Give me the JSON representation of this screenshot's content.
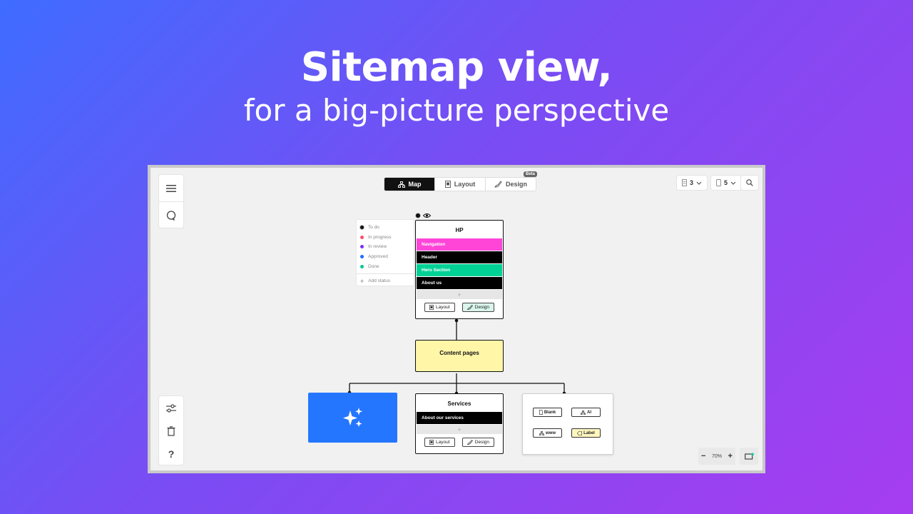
{
  "hero": {
    "title": "Sitemap view,",
    "subtitle": "for a big-picture perspective"
  },
  "toolbar": {
    "tabs": [
      {
        "label": "Map",
        "icon": "sitemap-icon",
        "active": true
      },
      {
        "label": "Layout",
        "icon": "layout-icon",
        "active": false
      },
      {
        "label": "Design",
        "icon": "design-icon",
        "active": false,
        "badge": "Beta"
      }
    ],
    "page_count": "3",
    "device_count": "5"
  },
  "sidebar": {
    "top": [
      "menu-icon",
      "comment-icon"
    ],
    "bottom": [
      "settings-sliders-icon",
      "trash-icon",
      "help-icon"
    ],
    "help_label": "?"
  },
  "status_menu": {
    "items": [
      {
        "label": "To do",
        "color": "#111111"
      },
      {
        "label": "In progress",
        "color": "#ff4d6d"
      },
      {
        "label": "In review",
        "color": "#7b2ff7"
      },
      {
        "label": "Approved",
        "color": "#1e6bff"
      },
      {
        "label": "Done",
        "color": "#00c896"
      }
    ],
    "add_label": "Add status"
  },
  "sitemap": {
    "hp": {
      "title": "HP",
      "sections": [
        {
          "label": "Navigation",
          "color": "#ff44d8"
        },
        {
          "label": "Header",
          "color": "#000000"
        },
        {
          "label": "Hero Section",
          "color": "#00d195"
        },
        {
          "label": "About us",
          "color": "#000000"
        }
      ],
      "add": "+",
      "layout_label": "Layout",
      "design_label": "Design"
    },
    "content": {
      "title": "Content pages",
      "color": "#fff6a8"
    },
    "ai_card": {
      "color": "#2576ff"
    },
    "services": {
      "title": "Services",
      "sections": [
        {
          "label": "About our services",
          "color": "#000000"
        }
      ],
      "add": "+",
      "layout_label": "Layout",
      "design_label": "Design"
    },
    "templates": {
      "buttons": [
        "Blank",
        "AI",
        "www",
        "Label"
      ]
    }
  },
  "zoom": {
    "minus": "−",
    "level": "70%",
    "plus": "+"
  },
  "colors": {
    "design_pill": "#d9f5ec",
    "label_pill": "#fff6c0"
  }
}
